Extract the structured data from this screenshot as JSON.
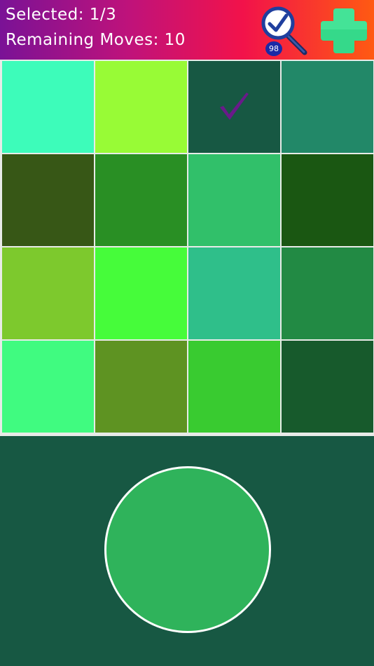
{
  "header": {
    "selected_text": "Selected: 1/3",
    "moves_text": "Remaining Moves: 10",
    "hint_count": "98",
    "hint_icon": "magnifier-check-icon",
    "add_icon": "plus-icon"
  },
  "colors": {
    "header_gradient": [
      "#7a1296",
      "#c0127a",
      "#f2124a",
      "#ff5a12"
    ],
    "background": "#175843",
    "check_mark": "#6a1a8a",
    "target": "#2fb35b"
  },
  "tiles": [
    {
      "color": "#3dfcba",
      "selected": false
    },
    {
      "color": "#98fb36",
      "selected": false
    },
    {
      "color": "#175843",
      "selected": true
    },
    {
      "color": "#228868",
      "selected": false
    },
    {
      "color": "#375716",
      "selected": false
    },
    {
      "color": "#298f24",
      "selected": false
    },
    {
      "color": "#31c06a",
      "selected": false
    },
    {
      "color": "#1a5712",
      "selected": false
    },
    {
      "color": "#7dc92d",
      "selected": false
    },
    {
      "color": "#46fc3a",
      "selected": false
    },
    {
      "color": "#2fbf8a",
      "selected": false
    },
    {
      "color": "#228a44",
      "selected": false
    },
    {
      "color": "#40fb80",
      "selected": false
    },
    {
      "color": "#5e9322",
      "selected": false
    },
    {
      "color": "#39cb30",
      "selected": false
    },
    {
      "color": "#175a2c",
      "selected": false
    }
  ],
  "target": {
    "color": "#2fb35b"
  }
}
